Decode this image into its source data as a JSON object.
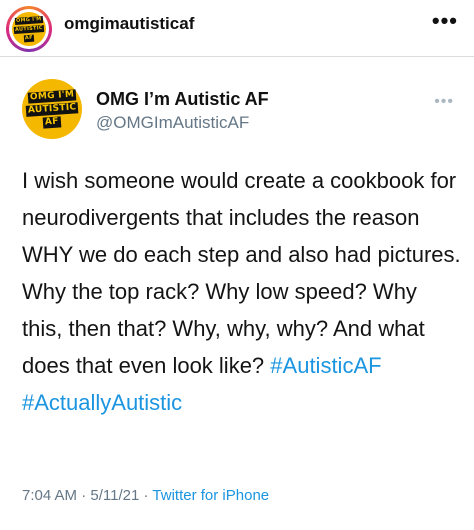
{
  "post_header": {
    "username": "omgimautisticaf",
    "more_icon": "•••",
    "avatar_logo": [
      "OMG I'M",
      "AUTISTIC",
      "AF"
    ]
  },
  "tweet": {
    "display_name": "OMG I’m Autistic AF",
    "handle": "@OMGImAutisticAF",
    "more_icon": "•••",
    "avatar_logo": [
      "OMG I'M",
      "AUTISTIC",
      "AF"
    ],
    "body": "I wish someone would create a cookbook for neurodivergents that includes the reason WHY we do each step and also had pictures. Why the top rack? Why low speed? Why this, then that? Why, why, why? And what does that even look like?",
    "hashtags": "#AutisticAF #ActuallyAutistic",
    "time": "7:04 AM",
    "separator": "·",
    "date": "5/11/21",
    "source": "Twitter for iPhone"
  },
  "colors": {
    "link": "#1b95e0",
    "secondary_text": "#657786",
    "logo_yellow": "#f5b800"
  }
}
